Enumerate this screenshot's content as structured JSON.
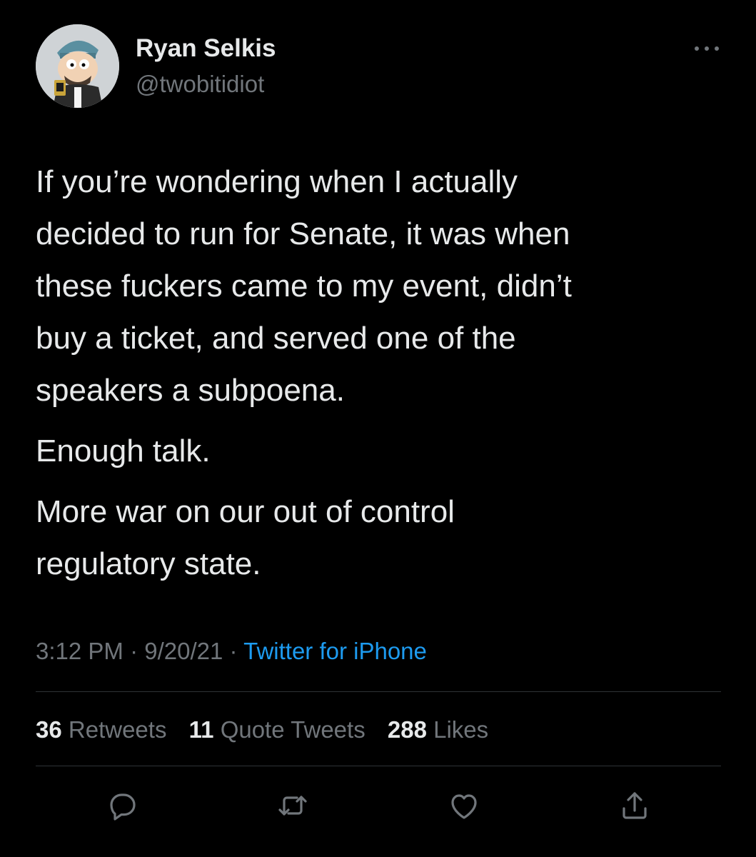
{
  "author": {
    "name": "Ryan Selkis",
    "handle": "@twobitidiot"
  },
  "icons": {
    "more": "more-horizontal-icon",
    "reply": "reply-icon",
    "retweet": "retweet-icon",
    "like": "heart-icon",
    "share": "share-icon"
  },
  "tweet": {
    "paragraphs": [
      "If you’re wondering when I actually\ndecided to run for Senate, it was when\nthese fuckers came to my event, didn’t\nbuy a ticket, and served one of the\nspeakers a subpoena.",
      "Enough talk.",
      "More war on our out of control\nregulatory state."
    ],
    "time": "3:12 PM",
    "separator": "·",
    "date": "9/20/21",
    "source": "Twitter for iPhone"
  },
  "stats": {
    "retweets_count": "36",
    "retweets_label": "Retweets",
    "quotes_count": "11",
    "quotes_label": "Quote Tweets",
    "likes_count": "288",
    "likes_label": "Likes"
  },
  "colors": {
    "background": "#000000",
    "text": "#e7e9ea",
    "secondary": "#71767b",
    "link": "#1d9bf0",
    "divider": "#2f3336"
  }
}
